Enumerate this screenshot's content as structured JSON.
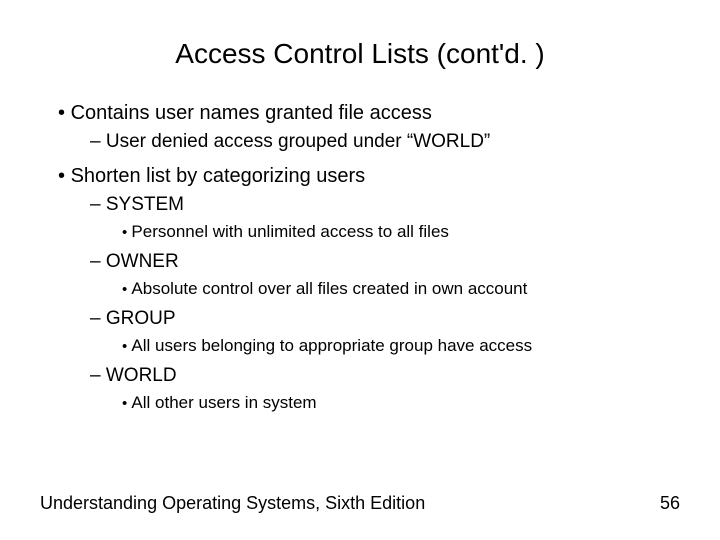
{
  "title": "Access Control Lists (cont'd. )",
  "bullets": {
    "b1": "Contains user names granted file access",
    "b1_1": "User denied access grouped under “WORLD”",
    "b2": "Shorten list by categorizing users",
    "b2_1": "SYSTEM",
    "b2_1_1": "Personnel with unlimited access to all files",
    "b2_2": "OWNER",
    "b2_2_1": "Absolute control over all files created in own account",
    "b2_3": "GROUP",
    "b2_3_1": "All users belonging to appropriate group have access",
    "b2_4": "WORLD",
    "b2_4_1": "All other users in system"
  },
  "footer": {
    "text": "Understanding Operating Systems, Sixth Edition",
    "page": "56"
  }
}
